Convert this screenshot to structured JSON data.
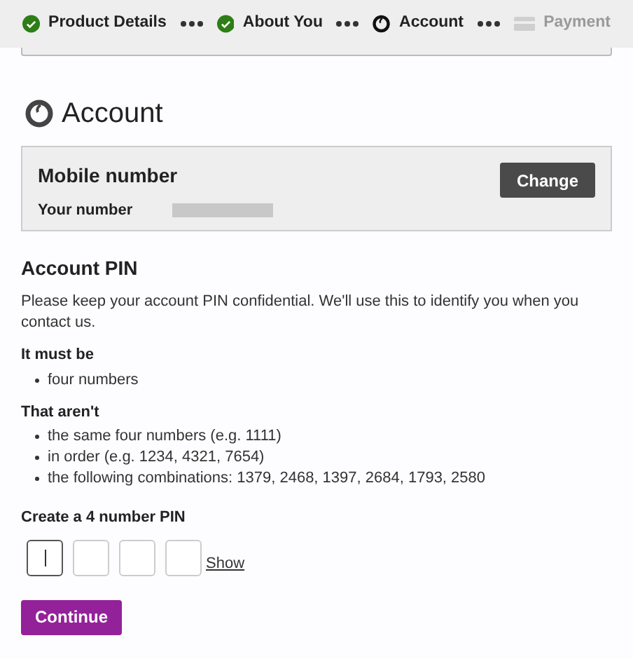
{
  "steps": [
    {
      "label": "Product Details",
      "kind": "done"
    },
    {
      "label": "About You",
      "kind": "done"
    },
    {
      "label": "Account",
      "kind": "current"
    },
    {
      "label": "Payment",
      "kind": "upcoming"
    }
  ],
  "section_title": "Account",
  "mobile_card": {
    "title": "Mobile number",
    "label": "Your number",
    "button": "Change"
  },
  "pin": {
    "title": "Account PIN",
    "intro": "Please keep your account PIN confidential. We'll use this to identify you when you contact us.",
    "rules": [
      {
        "heading": "It must be",
        "items": [
          "four numbers"
        ]
      },
      {
        "heading": "That aren't",
        "items": [
          "the same four numbers (e.g. 1111)",
          "in order (e.g. 1234, 4321, 7654)",
          "the following combinations: 1379, 2468, 1397, 2684, 1793, 2580"
        ]
      }
    ],
    "field_label": "Create a 4 number PIN",
    "boxes": [
      {
        "selected": true
      },
      {
        "selected": false
      },
      {
        "selected": false
      },
      {
        "selected": false
      }
    ],
    "show_link": "Show"
  },
  "continue_button": "Continue"
}
